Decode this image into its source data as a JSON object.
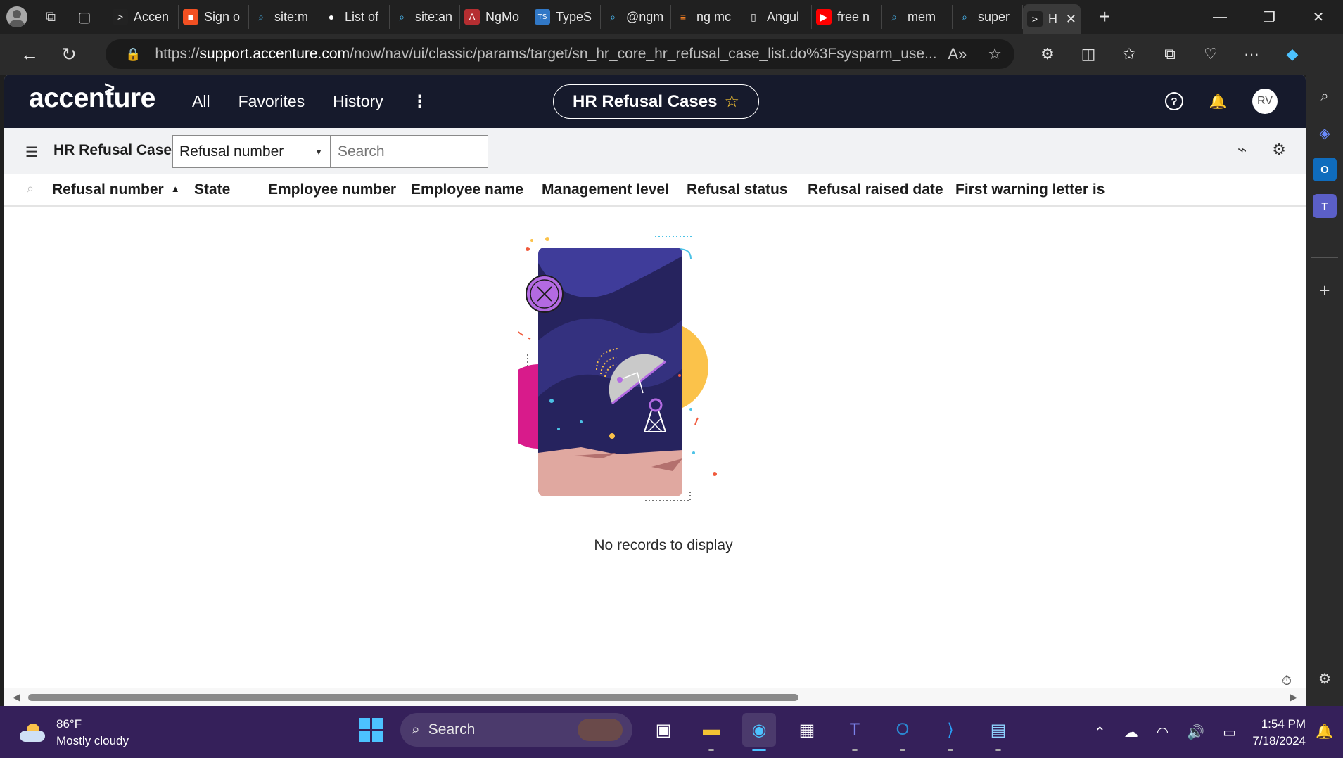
{
  "browser": {
    "tabs": [
      {
        "label": "Accen",
        "icon": "accenture-icon"
      },
      {
        "label": "Sign o",
        "icon": "microsoft-icon"
      },
      {
        "label": "site:m",
        "icon": "search-icon"
      },
      {
        "label": "List of",
        "icon": "medium-icon"
      },
      {
        "label": "site:an",
        "icon": "search-icon"
      },
      {
        "label": "NgMo",
        "icon": "angular-icon"
      },
      {
        "label": "TypeS",
        "icon": "typescript-icon"
      },
      {
        "label": "@ngm",
        "icon": "search-icon"
      },
      {
        "label": "ng mc",
        "icon": "stackoverflow-icon"
      },
      {
        "label": "Angul",
        "icon": "document-icon"
      },
      {
        "label": "free n",
        "icon": "youtube-icon"
      },
      {
        "label": "mem",
        "icon": "search-icon"
      },
      {
        "label": "super",
        "icon": "search-icon"
      },
      {
        "label": "H",
        "icon": "accenture-icon",
        "active": true
      }
    ],
    "url_prefix": "https://",
    "url_host": "support.accenture.com",
    "url_path": "/now/nav/ui/classic/params/target/sn_hr_core_hr_refusal_case_list.do%3Fsysparm_use..."
  },
  "app": {
    "logo_text": "accenture",
    "menu": [
      "All",
      "Favorites",
      "History"
    ],
    "context_title": "HR Refusal Cases",
    "avatar_initials": "RV"
  },
  "list": {
    "title": "HR Refusal Cases",
    "search_field": "Refusal number",
    "search_placeholder": "Search",
    "columns": [
      "Refusal number",
      "State",
      "Employee number",
      "Employee name",
      "Management level",
      "Refusal status",
      "Refusal raised date",
      "First warning letter is"
    ],
    "sorted_column": "Refusal number",
    "sort_direction": "ascending",
    "empty_message": "No records to display"
  },
  "taskbar": {
    "temperature": "86°F",
    "weather": "Mostly cloudy",
    "search_placeholder": "Search",
    "time": "1:54 PM",
    "date": "7/18/2024"
  },
  "colors": {
    "header_bg": "#161a2c",
    "accent_star": "#f3c233",
    "taskbar_bg": "#35205a",
    "illustration_night": "#2d2a6e",
    "illustration_pink": "#d81b8b",
    "illustration_yellow": "#fbc24a",
    "illustration_purple": "#b36ae2"
  }
}
